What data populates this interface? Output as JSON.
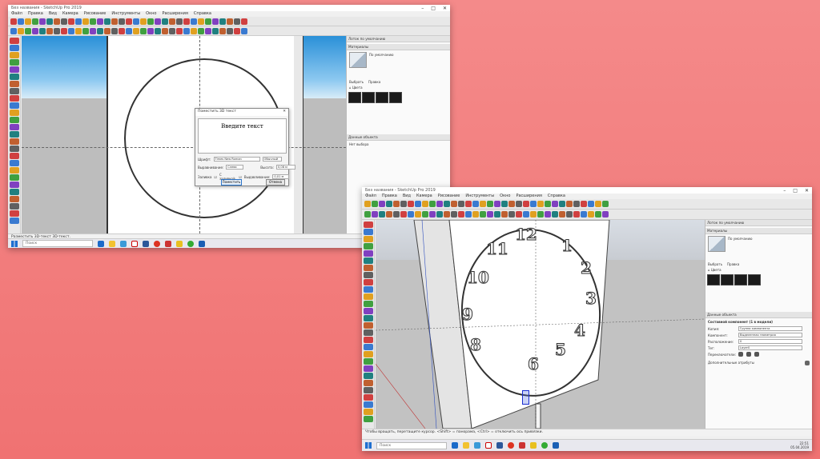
{
  "colors": {
    "background": "#f07272",
    "accent": "#2b74c9"
  },
  "shot1": {
    "title": "Без названия - SketchUp Pro 2019",
    "menu": [
      "Файл",
      "Правка",
      "Вид",
      "Камера",
      "Рисование",
      "Инструменты",
      "Окно",
      "Расширения",
      "Справка"
    ],
    "panels": {
      "materials_head": "Лоток по умолчанию",
      "materials_section": "Материалы",
      "default_label": "По умолчанию",
      "tab_choose": "Выбрать",
      "tab_edit": "Правка",
      "colors_label": "Цвета",
      "entity_head": "Данные объекта",
      "entity_value": "Нет выбора"
    },
    "dialog": {
      "title": "Поместить 3D текст",
      "text_value": "Введите текст",
      "font_label": "Шрифт:",
      "font_value": "Times New Roman",
      "style_value": "Обычный",
      "align_label": "Выравнивание:",
      "align_value": "Слева",
      "height_label": "Высота:",
      "height_value": "0,08 м",
      "fill_label": "Заливка",
      "fill_checkbox_label": "С заливкой",
      "extruded_label": "Выдавливание:",
      "extruded_value": "0,01 м",
      "place_button": "Поместить",
      "cancel_button": "Отмена"
    },
    "status_text": "Разместить 3D-текст 3D-текст.",
    "taskbar_search": "Поиск"
  },
  "shot2": {
    "title": "Без названия - SketchUp Pro 2019",
    "menu": [
      "Файл",
      "Правка",
      "Вид",
      "Камера",
      "Рисование",
      "Инструменты",
      "Окно",
      "Расширения",
      "Справка"
    ],
    "clock_numerals": [
      "12",
      "1",
      "2",
      "3",
      "4",
      "5",
      "6",
      "8",
      "9",
      "10",
      "11"
    ],
    "panels": {
      "tray_head": "Лоток по умолчанию",
      "materials_section": "Материалы",
      "default_label": "По умолчанию",
      "tab_choose": "Выбрать",
      "tab_edit": "Правка",
      "colors_label": "Цвета",
      "entity_head": "Данные объекта",
      "entity_value": "Составной компонент (1 в модели)",
      "instance_label": "Копия:",
      "instance_value": "Группа компонента",
      "definition_label": "Компонент:",
      "definition_value": "Выделенная геометрия",
      "owner_label": "Расположение:",
      "owner_value": "0",
      "tag_label": "Тег:",
      "tag_value": "Layer0",
      "toggles_label": "Переключатели:",
      "advanced_label": "Дополнительные атрибуты"
    },
    "status_text": "Чтобы вращать, перетащите курсор. <Shift> = панорама, <Ctrl> = отключить ось привязки.",
    "taskbar_search": "Поиск",
    "tray_time": "22:51",
    "tray_date": "05.04.2019"
  }
}
